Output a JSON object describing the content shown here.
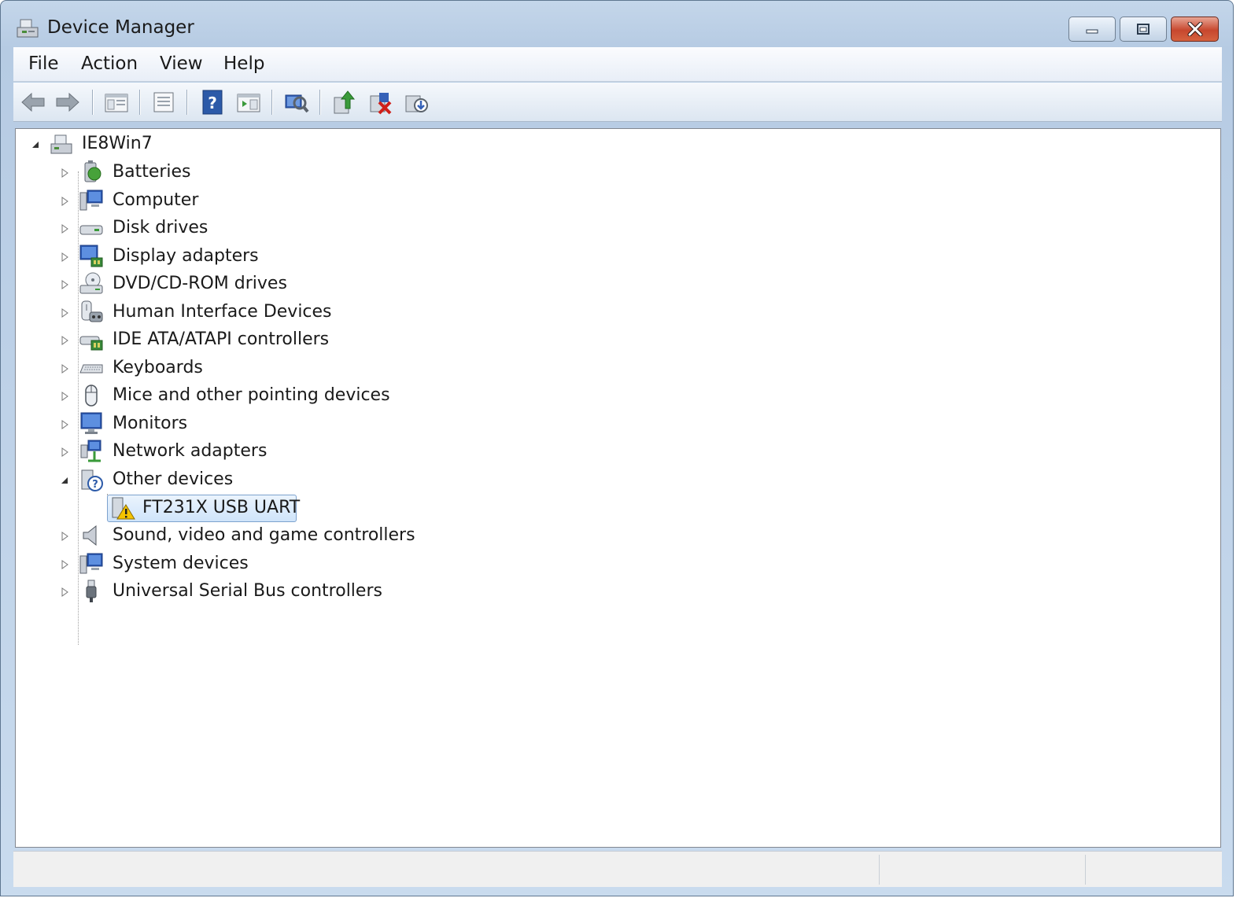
{
  "window": {
    "title": "Device Manager"
  },
  "menu": [
    "File",
    "Action",
    "View",
    "Help"
  ],
  "toolbar": [
    "back-icon",
    "forward-icon",
    "show-hide-tree-icon",
    "properties-icon",
    "help-icon",
    "action-pane-icon",
    "scan-hardware-icon",
    "update-driver-icon",
    "uninstall-icon",
    "disable-icon"
  ],
  "tree": {
    "root": "IE8Win7",
    "categories": [
      {
        "label": "Batteries",
        "icon": "battery-icon"
      },
      {
        "label": "Computer",
        "icon": "computer-icon"
      },
      {
        "label": "Disk drives",
        "icon": "disk-drive-icon"
      },
      {
        "label": "Display adapters",
        "icon": "display-adapter-icon"
      },
      {
        "label": "DVD/CD-ROM drives",
        "icon": "dvd-drive-icon"
      },
      {
        "label": "Human Interface Devices",
        "icon": "hid-icon"
      },
      {
        "label": "IDE ATA/ATAPI controllers",
        "icon": "ide-controller-icon"
      },
      {
        "label": "Keyboards",
        "icon": "keyboard-icon"
      },
      {
        "label": "Mice and other pointing devices",
        "icon": "mouse-icon"
      },
      {
        "label": "Monitors",
        "icon": "monitor-icon"
      },
      {
        "label": "Network adapters",
        "icon": "network-adapter-icon"
      },
      {
        "label": "Other devices",
        "icon": "unknown-device-icon",
        "expanded": true,
        "children": [
          {
            "label": "FT231X USB UART",
            "icon": "warning-device-icon",
            "selected": true
          }
        ]
      },
      {
        "label": "Sound, video and game controllers",
        "icon": "speaker-icon"
      },
      {
        "label": "System devices",
        "icon": "system-device-icon"
      },
      {
        "label": "Universal Serial Bus controllers",
        "icon": "usb-icon"
      }
    ]
  },
  "colors": {
    "selection_border": "#7da2ce",
    "close_button": "#c7472e",
    "warning": "#f5c400"
  }
}
